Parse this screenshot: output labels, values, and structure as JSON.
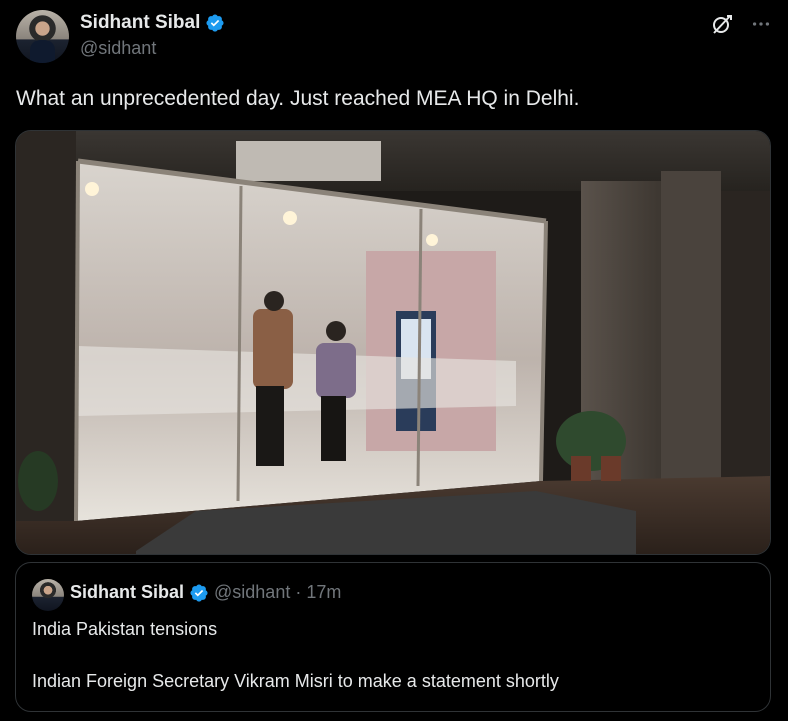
{
  "author": {
    "display_name": "Sidhant Sibal",
    "handle": "@sidhant"
  },
  "icons": {
    "verified": "verified-badge-icon",
    "grok": "grok-icon",
    "more": "more-icon"
  },
  "tweet": {
    "text": "What an unprecedented day. Just reached MEA HQ in Delhi."
  },
  "quote": {
    "display_name": "Sidhant Sibal",
    "handle": "@sidhant",
    "separator": "·",
    "time": "17m",
    "line1": "India Pakistan tensions",
    "line2": "Indian Foreign Secretary Vikram Misri to make a statement shortly"
  },
  "colors": {
    "background": "#000000",
    "text": "#e7e9ea",
    "muted": "#71767b",
    "verified": "#1d9bf0",
    "border": "#2f3336"
  }
}
